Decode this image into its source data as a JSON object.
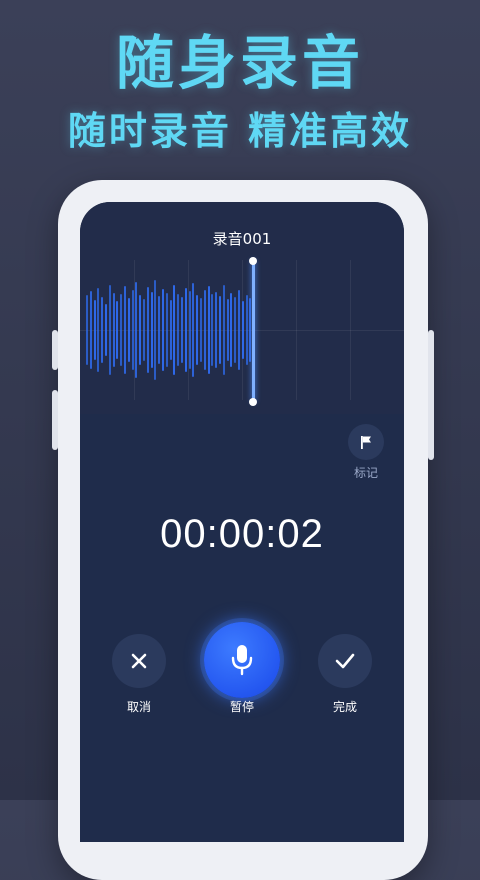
{
  "promo": {
    "headline": "随身录音",
    "subheadline": "随时录音 精准高效"
  },
  "recorder": {
    "title": "录音001",
    "timer": "00:00:02",
    "flag_label": "标记",
    "cancel_label": "取消",
    "pause_label": "暂停",
    "done_label": "完成"
  },
  "icons": {
    "flag": "flag-icon",
    "close": "close-icon",
    "mic": "microphone-icon",
    "check": "check-icon"
  },
  "colors": {
    "headline": "#5fd8f4",
    "waveform": "#2f6cf0",
    "accent": "#2457f0"
  }
}
